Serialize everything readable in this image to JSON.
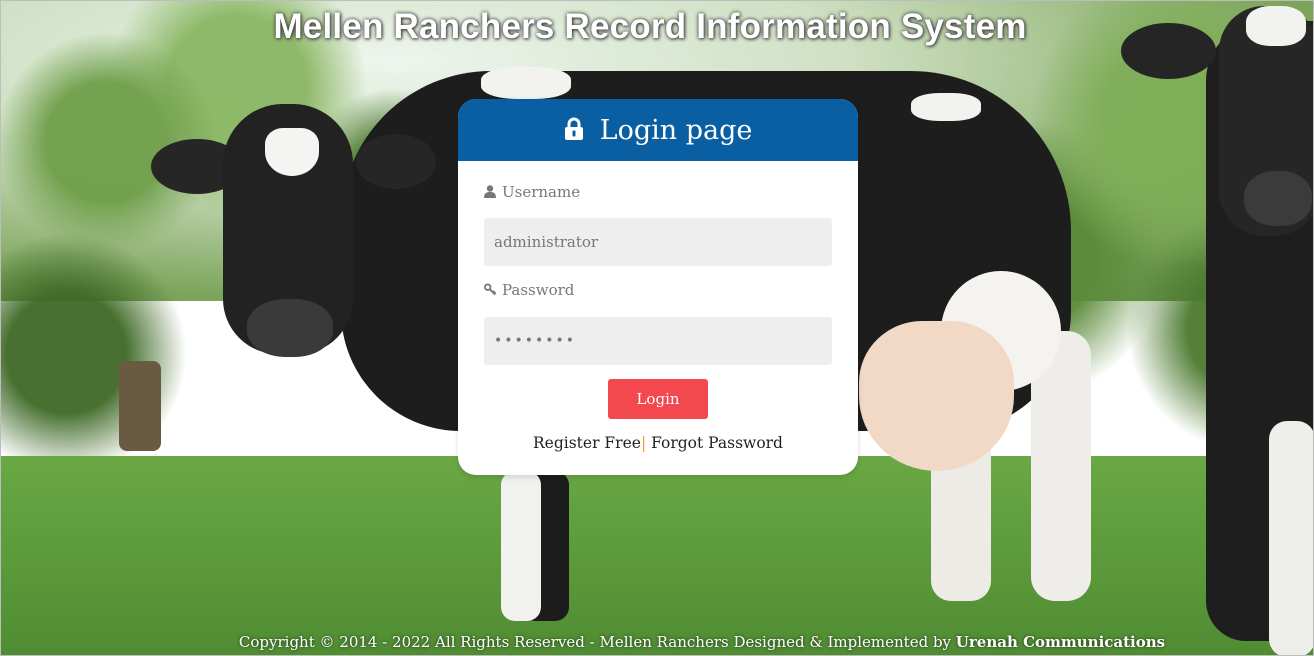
{
  "site": {
    "title": "Mellen Ranchers Record Information System"
  },
  "login": {
    "header": "Login page",
    "header_icon": "lock-icon",
    "username_label": "Username",
    "username_icon": "user-icon",
    "username_value": "administrator",
    "password_label": "Password",
    "password_icon": "key-icon",
    "password_masked": "••••••••",
    "button_label": "Login",
    "register_link": "Register Free",
    "separator": "|",
    "forgot_link": "Forgot Password"
  },
  "footer": {
    "text": "Copyright © 2014 - 2022 All Rights Reserved - Mellen Ranchers Designed & Implemented by ",
    "company": "Urenah Communications"
  },
  "colors": {
    "header_blue": "#0a5fa3",
    "button_red": "#f2484e",
    "input_bg": "#eeeeee",
    "separator_orange": "#f0a020"
  },
  "background_image": "pasture-with-holstein-cows"
}
